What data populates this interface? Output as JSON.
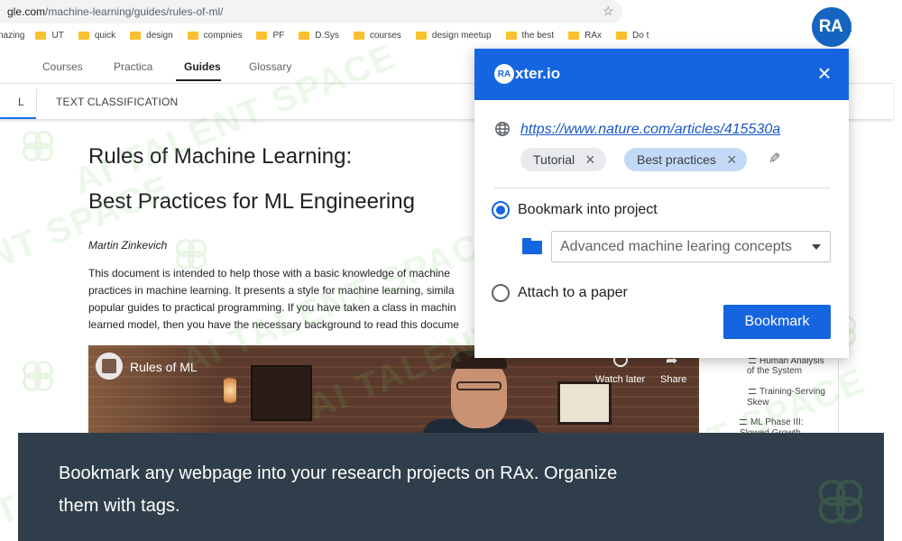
{
  "browser": {
    "url_host": "gle.com",
    "url_path": "/machine-learning/guides/rules-of-ml/",
    "bookmarks": [
      "nazing",
      "UT",
      "quick",
      "design",
      "compnies",
      "PF",
      "D.Sys",
      "courses",
      "design meetup",
      "the best",
      "RAx",
      "Do t"
    ]
  },
  "site": {
    "nav": [
      "Courses",
      "Practica",
      "Guides",
      "Glossary"
    ],
    "nav_active": "Guides",
    "subnav_prev": "L",
    "subnav_current": "TEXT CLASSIFICATION"
  },
  "doc": {
    "title": "Rules of Machine Learning:",
    "subtitle": "Best Practices for ML Engineering",
    "author": "Martin Zinkevich",
    "body_lines": [
      "This document is intended to help those with a basic knowledge of machine",
      "practices in machine learning. It presents a style for machine learning, simila",
      "popular guides to practical programming. If you have taken a class in machin",
      "learned model, then you have the necessary background to read this docume"
    ]
  },
  "video": {
    "title": "Rules of ML",
    "watch_later": "Watch later",
    "share": "Share"
  },
  "toc": {
    "items": [
      {
        "line1": "Human Analysis",
        "line2": "of the System"
      },
      {
        "line1": "Training-Serving",
        "line2": "Skew"
      },
      {
        "line1": "ML Phase III:",
        "line2": "Slowed Growth"
      }
    ]
  },
  "watermark": {
    "text": "AI TALENT SPACE",
    "partial_text": "NT SPACE",
    "color": "#6ec85a"
  },
  "rax": {
    "logo_letters": "RA",
    "logo_x": "x",
    "brand_badge": "RA",
    "brand_name": "xter.io",
    "article_url": "https://www.nature.com/articles/415530a",
    "tags": [
      "Tutorial",
      "Best practices"
    ],
    "option_bookmark": "Bookmark into project",
    "project_selected": "Advanced machine learing concepts",
    "option_attach": "Attach to a paper",
    "bookmark_button": "Bookmark",
    "accent_color": "#1565e0"
  },
  "caption": {
    "text": "Bookmark any webpage into your research projects on RAx. Organize them with tags.",
    "background": "#2f3e4a"
  }
}
